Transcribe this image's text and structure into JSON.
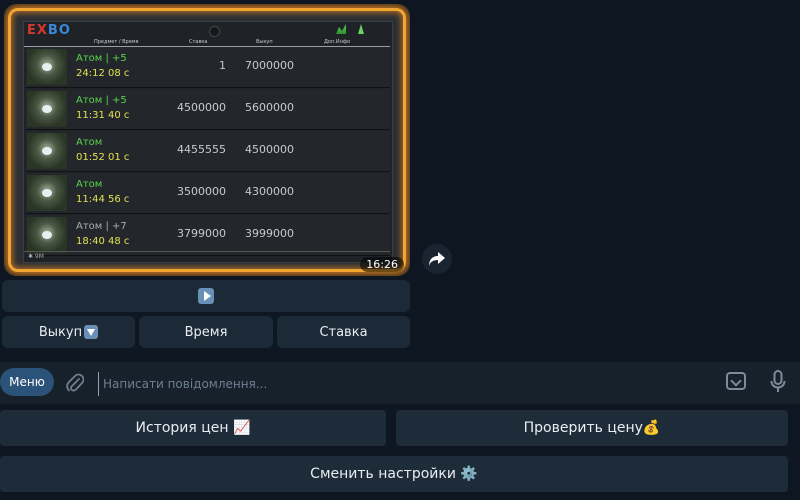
{
  "message": {
    "screen": {
      "logo_part1": "EX",
      "logo_part2": "BO",
      "columns": [
        "Предмет / Время",
        "Ставка",
        "Выкуп",
        "Доп.Инфо"
      ],
      "rows": [
        {
          "name": "Атом | +5",
          "time": "24:12 08 с",
          "bid": "1",
          "buyout": "7000000",
          "name_color": "green"
        },
        {
          "name": "Атом | +5",
          "time": "11:31 40 с",
          "bid": "4500000",
          "buyout": "5600000",
          "name_color": "green"
        },
        {
          "name": "Атом",
          "time": "01:52 01 с",
          "bid": "4455555",
          "buyout": "4500000",
          "name_color": "green"
        },
        {
          "name": "Атом",
          "time": "11:44 56 с",
          "bid": "3500000",
          "buyout": "4300000",
          "name_color": "green"
        },
        {
          "name": "Атом | +7",
          "time": "18:40 48 с",
          "bid": "3799000",
          "buyout": "3999000",
          "name_color": "grey"
        }
      ],
      "bottom_label": "✱ 9M"
    },
    "timestamp": "16:26",
    "inline_keyboard": {
      "play_icon": "play-icon",
      "buttons": [
        {
          "label": "Выкуп",
          "icon": "down-arrow-icon"
        },
        {
          "label": "Время"
        },
        {
          "label": "Ставка"
        }
      ]
    }
  },
  "composer": {
    "menu_label": "Меню",
    "placeholder": "Написати повідомлення..."
  },
  "reply_keyboard": {
    "price_history": "История цен 📈",
    "check_price": "Проверить цену💰",
    "change_settings": "Сменить настройки ⚙️"
  }
}
